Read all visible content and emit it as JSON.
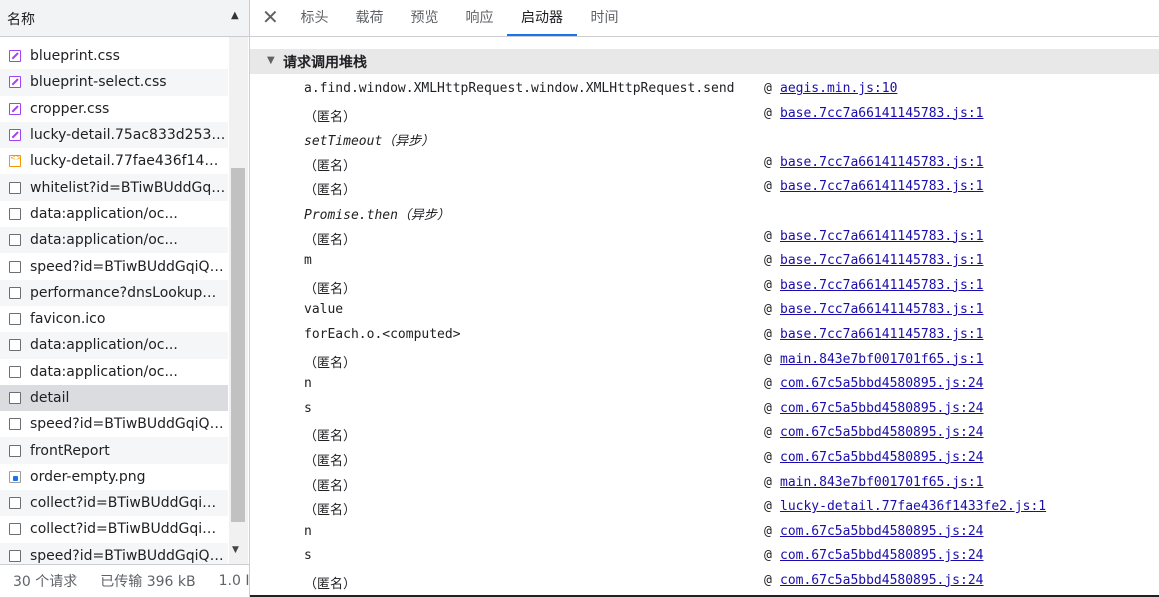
{
  "left_panel": {
    "header": "名称",
    "files": [
      {
        "name": "blueprint.css",
        "type": "css"
      },
      {
        "name": "blueprint-select.css",
        "type": "css"
      },
      {
        "name": "cropper.css",
        "type": "css"
      },
      {
        "name": "lucky-detail.75ac833d253e7...",
        "type": "css"
      },
      {
        "name": "lucky-detail.77fae436f1433f...",
        "type": "js"
      },
      {
        "name": "whitelist?id=BTiwBUddGqiQ...",
        "type": "doc"
      },
      {
        "name": "data:application/oc...",
        "type": "doc"
      },
      {
        "name": "data:application/oc...",
        "type": "doc"
      },
      {
        "name": "speed?id=BTiwBUddGqiQW...",
        "type": "doc"
      },
      {
        "name": "performance?dnsLookup=0...",
        "type": "doc"
      },
      {
        "name": "favicon.ico",
        "type": "doc"
      },
      {
        "name": "data:application/oc...",
        "type": "doc"
      },
      {
        "name": "data:application/oc...",
        "type": "doc"
      },
      {
        "name": "detail",
        "type": "doc"
      },
      {
        "name": "speed?id=BTiwBUddGqiQW...",
        "type": "doc"
      },
      {
        "name": "frontReport",
        "type": "doc"
      },
      {
        "name": "order-empty.png",
        "type": "img"
      },
      {
        "name": "collect?id=BTiwBUddGqiQ...",
        "type": "doc"
      },
      {
        "name": "collect?id=BTiwBUddGqiQ...",
        "type": "doc"
      },
      {
        "name": "speed?id=BTiwBUddGqiQW...",
        "type": "doc"
      }
    ],
    "selected_index": 13,
    "status": {
      "requests": "30 个请求",
      "transferred": "已传输 396 kB",
      "resources": "1.0 I"
    }
  },
  "tabs": [
    "标头",
    "载荷",
    "预览",
    "响应",
    "启动器",
    "时间"
  ],
  "active_tab": "启动器",
  "section": {
    "label": "请求调用堆栈"
  },
  "call_stack": [
    {
      "fn": "a.find.window.XMLHttpRequest.window.XMLHttpRequest.send",
      "at": "@",
      "src": "aegis.min.js:10"
    },
    {
      "fn": "（匿名）",
      "at": "@",
      "src": "base.7cc7a66141145783.js:1"
    },
    {
      "fn": "setTimeout（异步）",
      "at": "",
      "src": "",
      "async": true
    },
    {
      "fn": "（匿名）",
      "at": "@",
      "src": "base.7cc7a66141145783.js:1"
    },
    {
      "fn": "（匿名）",
      "at": "@",
      "src": "base.7cc7a66141145783.js:1"
    },
    {
      "fn": "Promise.then（异步）",
      "at": "",
      "src": "",
      "async": true
    },
    {
      "fn": "（匿名）",
      "at": "@",
      "src": "base.7cc7a66141145783.js:1"
    },
    {
      "fn": "m",
      "at": "@",
      "src": "base.7cc7a66141145783.js:1"
    },
    {
      "fn": "（匿名）",
      "at": "@",
      "src": "base.7cc7a66141145783.js:1"
    },
    {
      "fn": "value",
      "at": "@",
      "src": "base.7cc7a66141145783.js:1"
    },
    {
      "fn": "forEach.o.<computed>",
      "at": "@",
      "src": "base.7cc7a66141145783.js:1"
    },
    {
      "fn": "（匿名）",
      "at": "@",
      "src": "main.843e7bf001701f65.js:1"
    },
    {
      "fn": "n",
      "at": "@",
      "src": "com.67c5a5bbd4580895.js:24"
    },
    {
      "fn": "s",
      "at": "@",
      "src": "com.67c5a5bbd4580895.js:24"
    },
    {
      "fn": "（匿名）",
      "at": "@",
      "src": "com.67c5a5bbd4580895.js:24"
    },
    {
      "fn": "（匿名）",
      "at": "@",
      "src": "com.67c5a5bbd4580895.js:24"
    },
    {
      "fn": "（匿名）",
      "at": "@",
      "src": "main.843e7bf001701f65.js:1"
    },
    {
      "fn": "（匿名）",
      "at": "@",
      "src": "lucky-detail.77fae436f1433fe2.js:1"
    },
    {
      "fn": "n",
      "at": "@",
      "src": "com.67c5a5bbd4580895.js:24"
    },
    {
      "fn": "s",
      "at": "@",
      "src": "com.67c5a5bbd4580895.js:24"
    },
    {
      "fn": "（匿名）",
      "at": "@",
      "src": "com.67c5a5bbd4580895.js:24"
    }
  ],
  "icons": {
    "close": "close-icon",
    "sort": "sort-up-icon",
    "expand": "triangle-down-icon",
    "scroll_down": "scroll-down-icon"
  },
  "colors": {
    "accent": "#1a73e8",
    "link": "#1a0dab",
    "css_icon": "#a142f4",
    "js_icon": "#f29900",
    "selected_row": "#dadce0"
  }
}
